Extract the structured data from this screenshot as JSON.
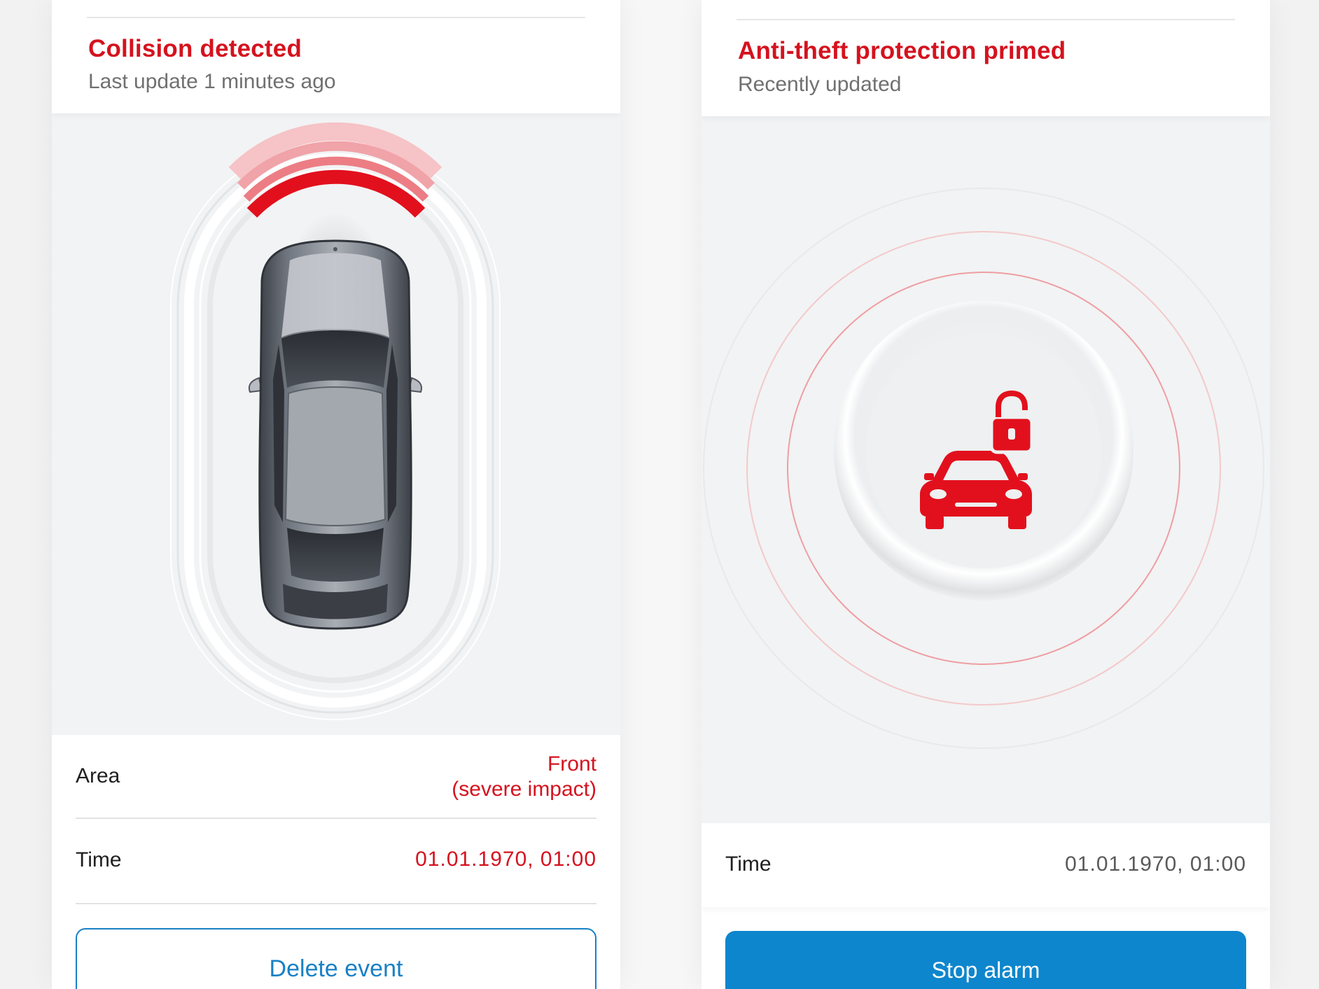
{
  "left_panel": {
    "title": "Collision detected",
    "subtitle": "Last update 1 minutes ago",
    "area": {
      "label": "Area",
      "value_line1": "Front",
      "value_line2": "(severe impact)"
    },
    "time": {
      "label": "Time",
      "value": "01.01.1970, 01:00"
    },
    "button_label": "Delete event",
    "impact_zone": "front"
  },
  "right_panel": {
    "title": "Anti-theft protection primed",
    "subtitle": "Recently updated",
    "time": {
      "label": "Time",
      "value": "01.01.1970, 01:00"
    },
    "button_label": "Stop alarm",
    "center_icon": "car-unlock-icon"
  },
  "colors": {
    "alert_red": "#d5121e",
    "action_blue": "#1a80c6",
    "button_blue": "#0d86cd",
    "muted_text": "#707070"
  }
}
